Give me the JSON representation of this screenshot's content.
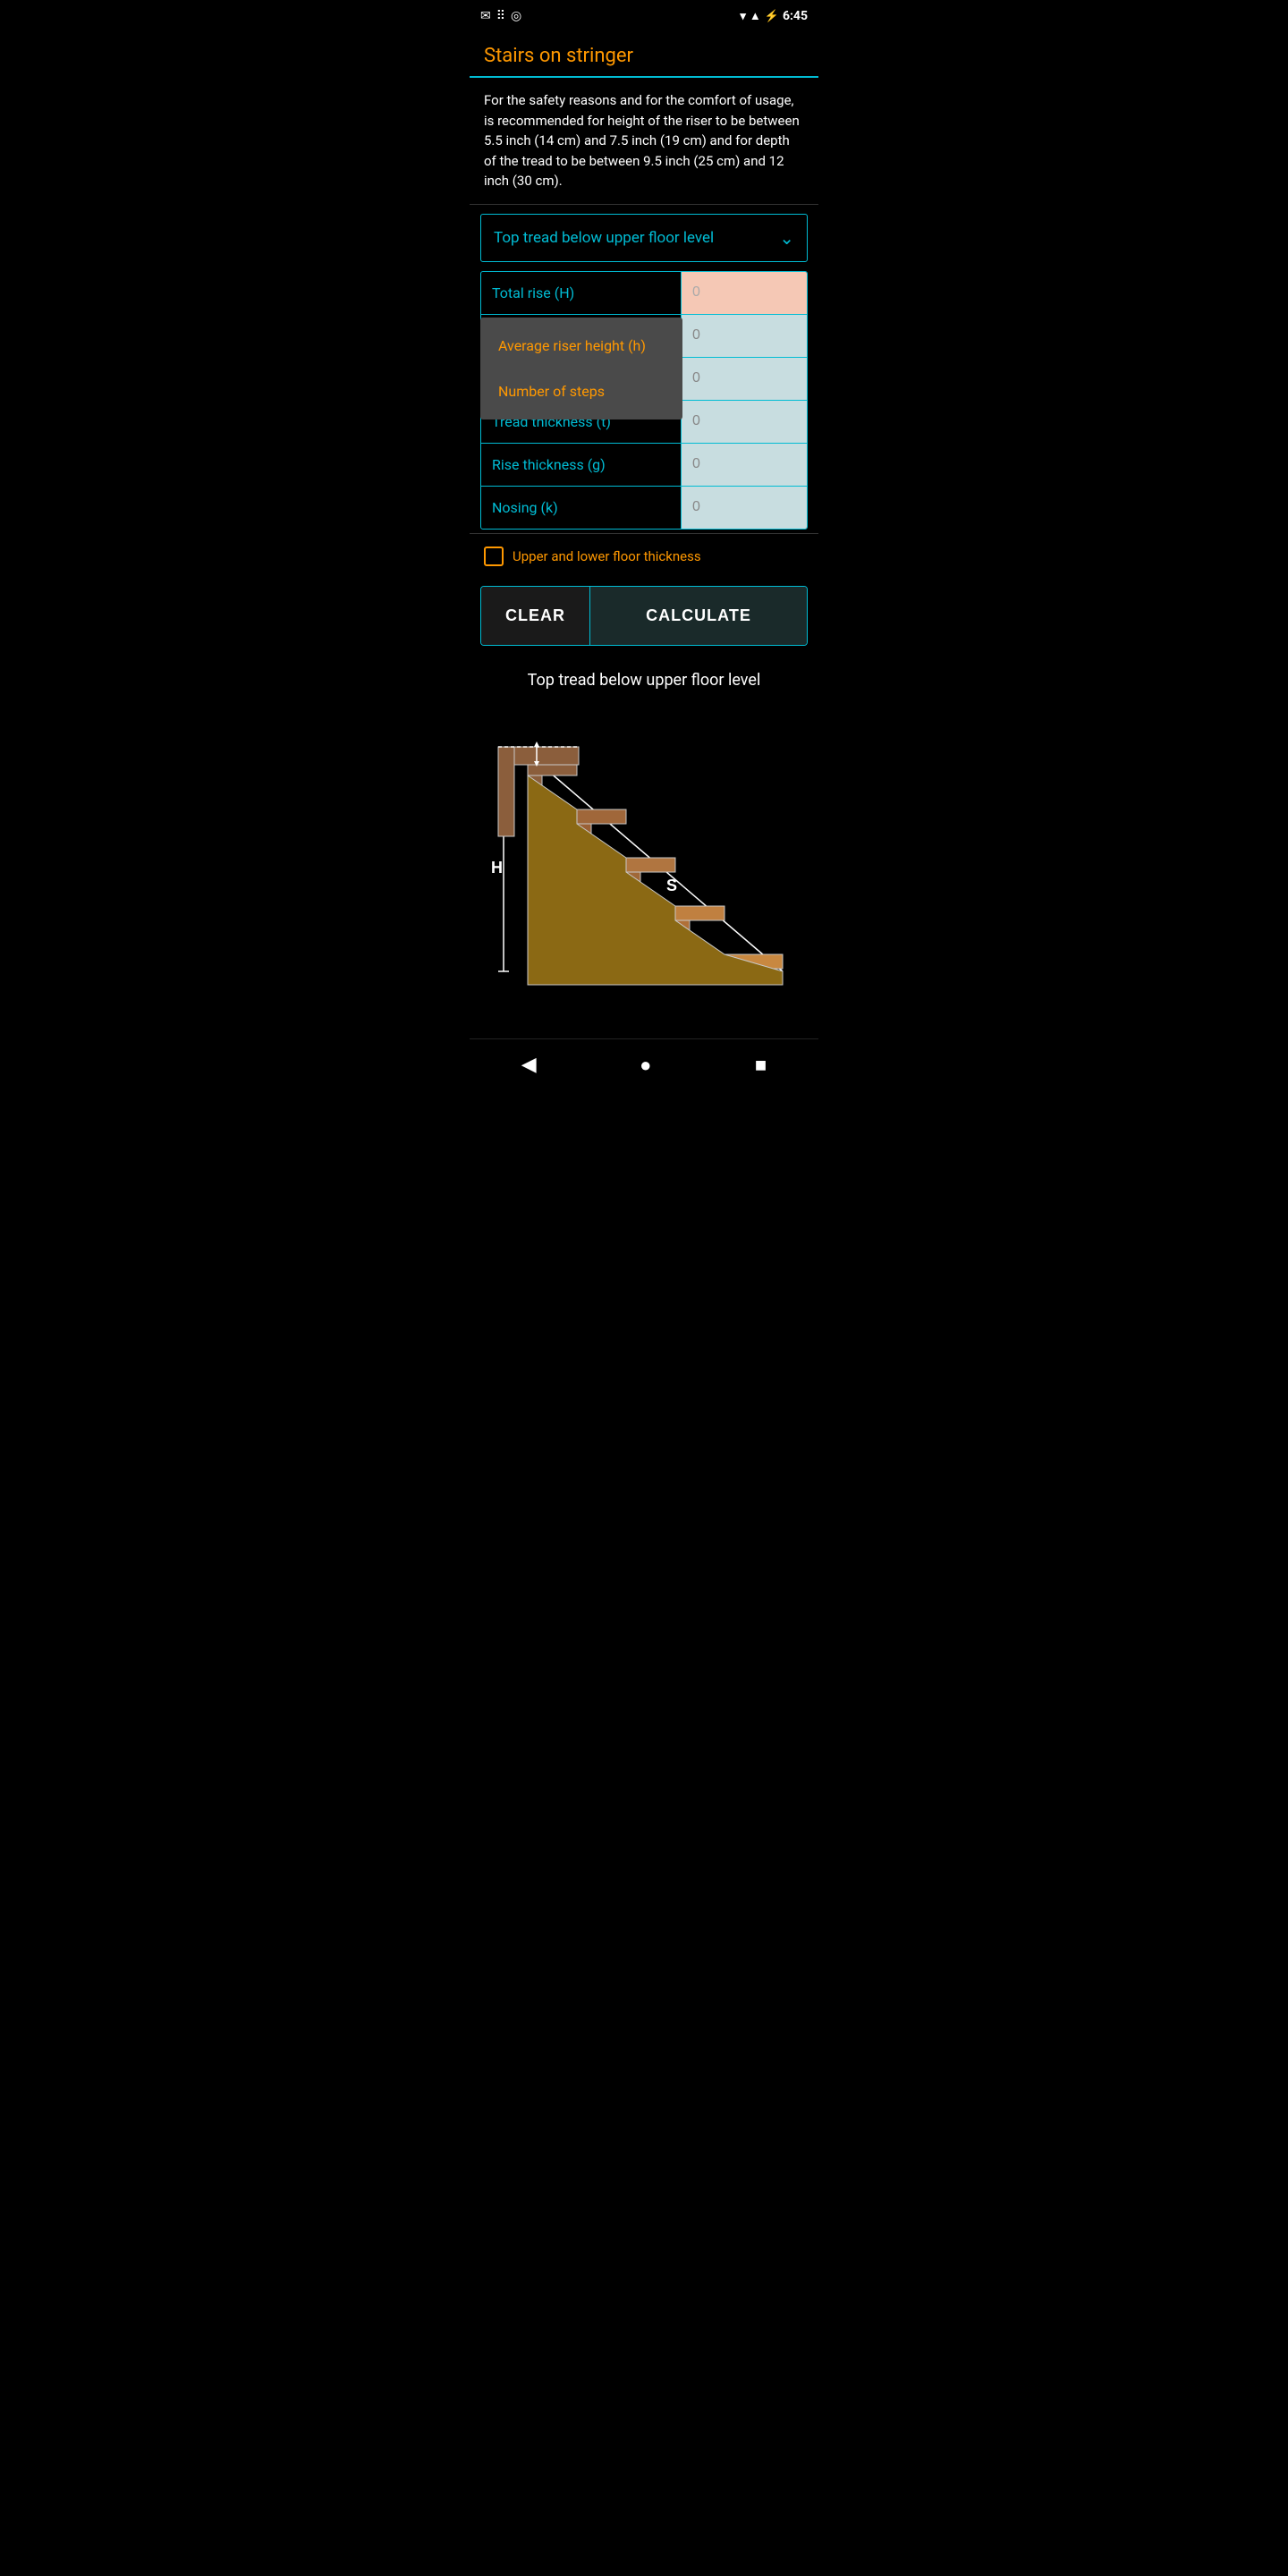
{
  "statusBar": {
    "time": "6:45",
    "icons": {
      "wifi": "▼",
      "signal": "▲",
      "battery": "🔋"
    }
  },
  "appBar": {
    "title": "Stairs on stringer"
  },
  "description": {
    "text": "For the safety reasons and for the comfort of usage, is recommended for height of the riser to be between 5.5 inch (14 cm) and 7.5 inch (19 cm) and for depth of the tread to be between 9.5 inch (25 cm) and 12 inch (30 cm)."
  },
  "dropdown": {
    "label": "Top tread below upper floor level",
    "options": [
      "Top tread below upper floor level",
      "Average riser height (h)",
      "Number of steps"
    ]
  },
  "formFields": [
    {
      "label": "Total rise (H)",
      "value": "0",
      "inputType": "red",
      "labelColor": "cyan"
    },
    {
      "label": "Average riser height (h)",
      "value": "0",
      "inputType": "blue",
      "labelColor": "orange"
    },
    {
      "label": "Number of steps",
      "value": "0",
      "inputType": "blue",
      "labelColor": "orange"
    },
    {
      "label": "Tread thickness (t)",
      "value": "0",
      "inputType": "blue",
      "labelColor": "cyan"
    },
    {
      "label": "Rise thickness (g)",
      "value": "0",
      "inputType": "blue",
      "labelColor": "cyan"
    },
    {
      "label": "Nosing (k)",
      "value": "0",
      "inputType": "blue",
      "labelColor": "cyan"
    }
  ],
  "dropdownItems": [
    "Average riser height (h)",
    "Number of steps"
  ],
  "checkbox": {
    "label": "Upper and lower floor thickness",
    "checked": false
  },
  "buttons": {
    "clear": "CLEAR",
    "calculate": "CALCULATE"
  },
  "diagram": {
    "title": "Top tread below upper floor level",
    "labels": {
      "h": "H",
      "s": "S"
    }
  },
  "navBar": {
    "back": "◀",
    "home": "●",
    "square": "■"
  }
}
